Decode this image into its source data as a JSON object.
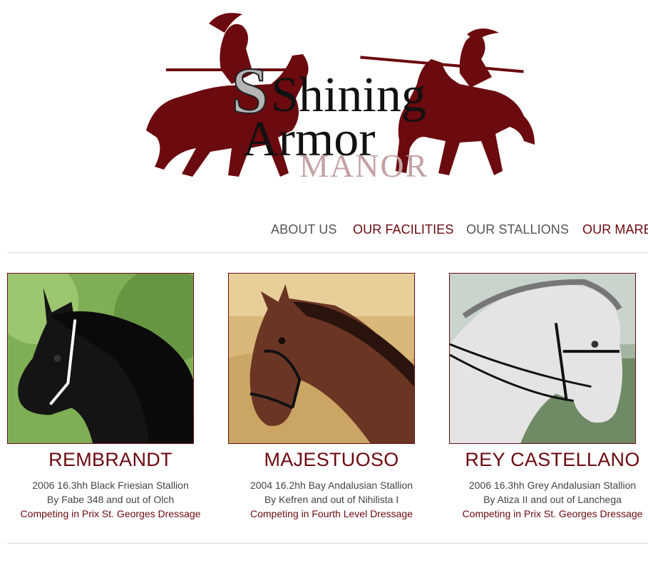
{
  "brand": {
    "logo_line1": "Shining",
    "logo_line2": "Armor",
    "logo_line3": "MANOR",
    "maroon": "#6b0a0f",
    "manor_color": "#c4a1a3"
  },
  "nav": {
    "items": [
      {
        "label": "ABOUT US"
      },
      {
        "label": "OUR FACILITIES"
      },
      {
        "label": "OUR STALLIONS"
      },
      {
        "label": "OUR MARE"
      }
    ]
  },
  "stallions": [
    {
      "name": "REMBRANDT",
      "details": "2006 16.3hh Black Friesian Stallion",
      "lineage": "By Fabe 348 and out of Olch",
      "competition": "Competing in Prix St. Georges Dressage",
      "photo_icon": "black-horse-photo"
    },
    {
      "name": "MAJESTUOSO",
      "details": "2004 16.2hh Bay Andalusian Stallion",
      "lineage": "By Kefren and out of Nihilista I",
      "competition": "Competing in Fourth Level Dressage",
      "photo_icon": "bay-horse-photo"
    },
    {
      "name": "REY CASTELLANO",
      "details": "2006 16.3hh Grey Andalusian Stallion",
      "lineage": "By Atiza II and out of Lanchega",
      "competition": "Competing in Prix St. Georges Dressage",
      "photo_icon": "grey-horse-photo"
    }
  ]
}
